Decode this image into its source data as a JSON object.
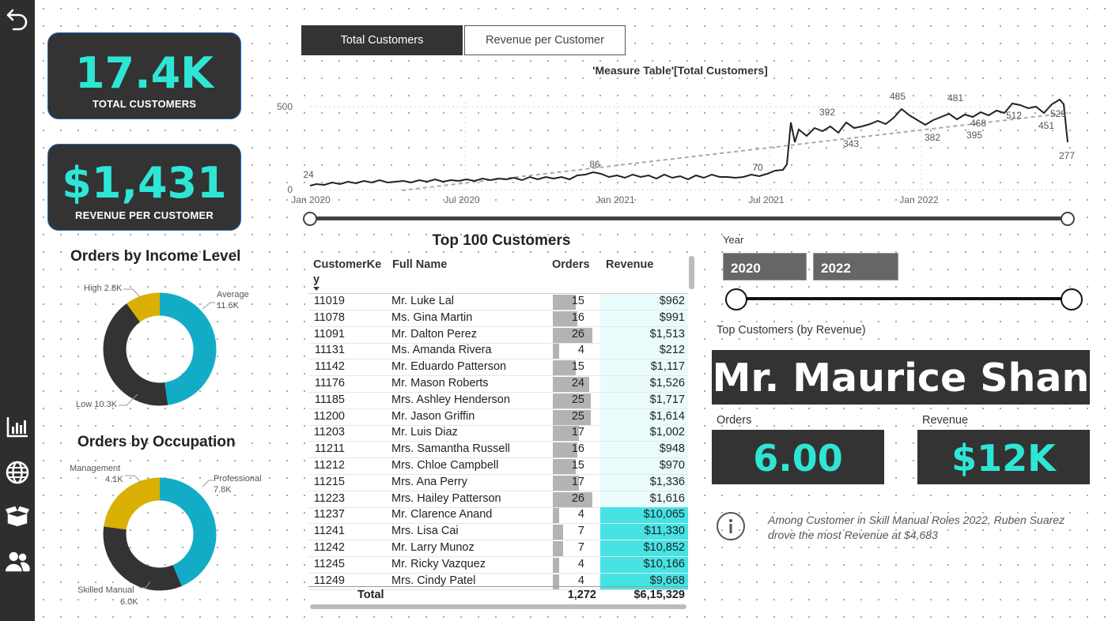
{
  "kpis": {
    "total_customers": {
      "value": "17.4K",
      "label": "TOTAL CUSTOMERS"
    },
    "revenue_per_customer": {
      "value": "$1,431",
      "label": "REVENUE PER CUSTOMER"
    }
  },
  "tabs": [
    {
      "label": "Total Customers",
      "active": true
    },
    {
      "label": "Revenue per Customer",
      "active": false
    }
  ],
  "line_chart": {
    "title": "'Measure Table'[Total Customers]",
    "y_ticks": [
      "500",
      "0"
    ],
    "x_ticks": [
      "Jan 2020",
      "Jul 2020",
      "Jan 2021",
      "Jul 2021",
      "Jan 2022"
    ],
    "data_labels": [
      "24",
      "86",
      "70",
      "392",
      "343",
      "485",
      "382",
      "481",
      "468",
      "395",
      "512",
      "451",
      "529",
      "277"
    ]
  },
  "chart_data": [
    {
      "type": "line",
      "title": "'Measure Table'[Total Customers]",
      "x": [
        "Jan 2020",
        "Jul 2020",
        "Jan 2021",
        "Jul 2021",
        "Jan 2022"
      ],
      "ylim": [
        0,
        540
      ],
      "series": [
        {
          "values": [
            24,
            86,
            70,
            392,
            343,
            485,
            382,
            481,
            468,
            395,
            512,
            451,
            529,
            277
          ]
        }
      ],
      "trend_line": true
    },
    {
      "type": "pie",
      "title": "Orders by Income Level",
      "categories": [
        "Average",
        "Low",
        "High"
      ],
      "values": [
        11.6,
        10.3,
        2.8
      ],
      "value_labels": [
        "11.6K",
        "10.3K",
        "2.8K"
      ],
      "colors": [
        "#13acc6",
        "#333333",
        "#d9b003"
      ]
    },
    {
      "type": "pie",
      "title": "Orders by Occupation",
      "categories": [
        "Professional",
        "Skilled Manual",
        "Management"
      ],
      "values": [
        7.8,
        6.0,
        4.1
      ],
      "value_labels": [
        "7.8K",
        "6.0K",
        "4.1K"
      ],
      "colors": [
        "#13acc6",
        "#333333",
        "#d9b003"
      ]
    }
  ],
  "donut_income": {
    "title": "Orders by Income Level",
    "labels": {
      "high": "High 2.8K",
      "average": "Average",
      "average_val": "11.6K",
      "low": "Low 10.3K"
    }
  },
  "donut_occupation": {
    "title": "Orders by Occupation",
    "labels": {
      "management": "Management",
      "management_val": "4.1K",
      "professional": "Professional",
      "professional_val": "7.8K",
      "skilled": "Skilled Manual",
      "skilled_val": "6.0K"
    }
  },
  "table": {
    "title": "Top 100 Customers",
    "headers": {
      "key": "CustomerKe",
      "key2": "y",
      "name": "Full Name",
      "orders": "Orders",
      "revenue": "Revenue"
    },
    "rows": [
      {
        "key": "11019",
        "name": "Mr. Luke Lal",
        "orders": "15",
        "revenue": "$962",
        "o": 15,
        "r": 962
      },
      {
        "key": "11078",
        "name": "Ms. Gina Martin",
        "orders": "16",
        "revenue": "$991",
        "o": 16,
        "r": 991
      },
      {
        "key": "11091",
        "name": "Mr. Dalton Perez",
        "orders": "26",
        "revenue": "$1,513",
        "o": 26,
        "r": 1513
      },
      {
        "key": "11131",
        "name": "Ms. Amanda Rivera",
        "orders": "4",
        "revenue": "$212",
        "o": 4,
        "r": 212
      },
      {
        "key": "11142",
        "name": "Mr. Eduardo Patterson",
        "orders": "15",
        "revenue": "$1,117",
        "o": 15,
        "r": 1117
      },
      {
        "key": "11176",
        "name": "Mr. Mason Roberts",
        "orders": "24",
        "revenue": "$1,526",
        "o": 24,
        "r": 1526
      },
      {
        "key": "11185",
        "name": "Mrs. Ashley Henderson",
        "orders": "25",
        "revenue": "$1,717",
        "o": 25,
        "r": 1717
      },
      {
        "key": "11200",
        "name": "Mr. Jason Griffin",
        "orders": "25",
        "revenue": "$1,614",
        "o": 25,
        "r": 1614
      },
      {
        "key": "11203",
        "name": "Mr. Luis Diaz",
        "orders": "17",
        "revenue": "$1,002",
        "o": 17,
        "r": 1002
      },
      {
        "key": "11211",
        "name": "Mrs. Samantha Russell",
        "orders": "16",
        "revenue": "$948",
        "o": 16,
        "r": 948
      },
      {
        "key": "11212",
        "name": "Mrs. Chloe Campbell",
        "orders": "15",
        "revenue": "$970",
        "o": 15,
        "r": 970
      },
      {
        "key": "11215",
        "name": "Mrs. Ana Perry",
        "orders": "17",
        "revenue": "$1,336",
        "o": 17,
        "r": 1336
      },
      {
        "key": "11223",
        "name": "Mrs. Hailey Patterson",
        "orders": "26",
        "revenue": "$1,616",
        "o": 26,
        "r": 1616
      },
      {
        "key": "11237",
        "name": "Mr. Clarence Anand",
        "orders": "4",
        "revenue": "$10,065",
        "o": 4,
        "r": 10065
      },
      {
        "key": "11241",
        "name": "Mrs. Lisa Cai",
        "orders": "7",
        "revenue": "$11,330",
        "o": 7,
        "r": 11330
      },
      {
        "key": "11242",
        "name": "Mr. Larry Munoz",
        "orders": "7",
        "revenue": "$10,852",
        "o": 7,
        "r": 10852
      },
      {
        "key": "11245",
        "name": "Mr. Ricky Vazquez",
        "orders": "4",
        "revenue": "$10,166",
        "o": 4,
        "r": 10166
      },
      {
        "key": "11249",
        "name": "Mrs. Cindy Patel",
        "orders": "4",
        "revenue": "$9,668",
        "o": 4,
        "r": 9668
      }
    ],
    "total": {
      "label": "Total",
      "orders": "1,272",
      "revenue": "$6,15,329"
    }
  },
  "year_slicer": {
    "label": "Year",
    "from": "2020",
    "to": "2022"
  },
  "top_customer": {
    "label": "Top Customers (by Revenue)",
    "name": "Mr. Maurice Shan"
  },
  "orders_card": {
    "label": "Orders",
    "value": "6.00"
  },
  "revenue_card": {
    "label": "Revenue",
    "value": "$12K"
  },
  "insight": {
    "text": "Among Customer in Skill Manual Roles 2022, Ruben Suarez drove the most Revenue at $4,683"
  },
  "colors": {
    "accent": "#2ee6d6",
    "teal": "#13acc6",
    "gold": "#d9b003",
    "dark": "#333333",
    "cyan_cell": "#45e3e3",
    "pale_cell": "#eafbfb"
  }
}
